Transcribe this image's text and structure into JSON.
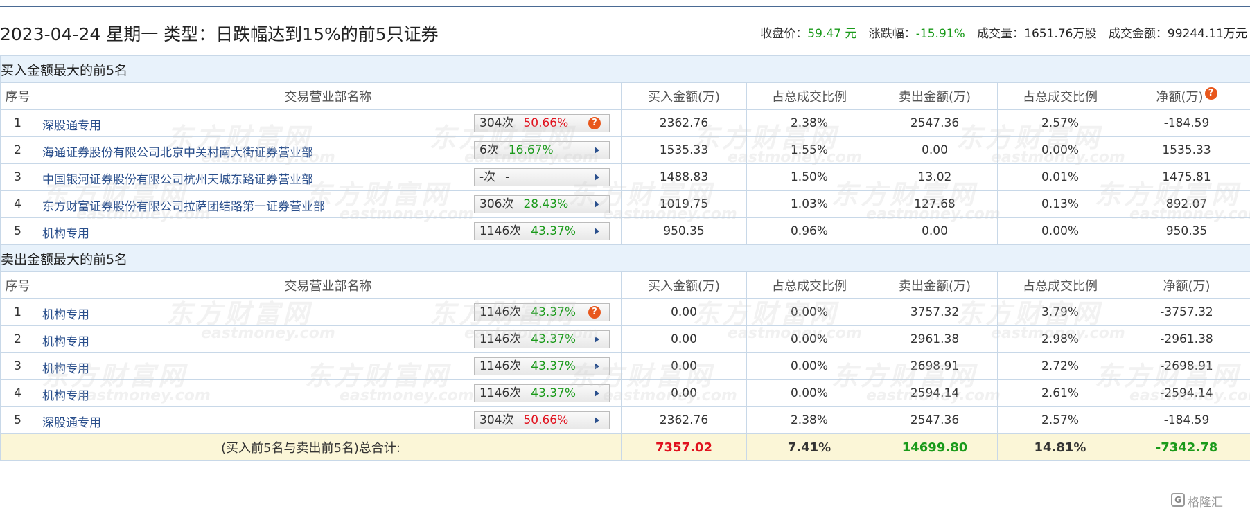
{
  "header": {
    "title": "2023-04-24 星期一 类型：日跌幅达到15%的前5只证券",
    "close_label": "收盘价：",
    "close_value": "59.47 元",
    "change_label": "涨跌幅：",
    "change_value": "-15.91%",
    "volume_label": "成交量：",
    "volume_value": "1651.76万股",
    "amount_label": "成交金额：",
    "amount_value": "99244.11万元"
  },
  "columns": {
    "seq": "序号",
    "name": "交易营业部名称",
    "buy": "买入金额(万)",
    "buy_ratio": "占总成交比例",
    "sell": "卖出金额(万)",
    "sell_ratio": "占总成交比例",
    "net": "净额(万)"
  },
  "help_icon": "question-icon",
  "buy_section": {
    "title": "买入金额最大的前5名",
    "rows": [
      {
        "seq": "1",
        "name": "深股通专用",
        "count": "304次",
        "pct": "50.66%",
        "pct_color": "red",
        "buy": "2362.76",
        "buy_ratio": "2.38%",
        "sell": "2547.36",
        "sell_ratio": "2.57%",
        "net": "-184.59"
      },
      {
        "seq": "2",
        "name": "海通证券股份有限公司北京中关村南大街证券营业部",
        "count": "6次",
        "pct": "16.67%",
        "pct_color": "green",
        "buy": "1535.33",
        "buy_ratio": "1.55%",
        "sell": "0.00",
        "sell_ratio": "0.00%",
        "net": "1535.33"
      },
      {
        "seq": "3",
        "name": "中国银河证券股份有限公司杭州天城东路证券营业部",
        "count": "-次",
        "pct": "-",
        "pct_color": "plain",
        "buy": "1488.83",
        "buy_ratio": "1.50%",
        "sell": "13.02",
        "sell_ratio": "0.01%",
        "net": "1475.81"
      },
      {
        "seq": "4",
        "name": "东方财富证券股份有限公司拉萨团结路第一证券营业部",
        "count": "306次",
        "pct": "28.43%",
        "pct_color": "green",
        "buy": "1019.75",
        "buy_ratio": "1.03%",
        "sell": "127.68",
        "sell_ratio": "0.13%",
        "net": "892.07"
      },
      {
        "seq": "5",
        "name": "机构专用",
        "count": "1146次",
        "pct": "43.37%",
        "pct_color": "green",
        "buy": "950.35",
        "buy_ratio": "0.96%",
        "sell": "0.00",
        "sell_ratio": "0.00%",
        "net": "950.35"
      }
    ]
  },
  "sell_section": {
    "title": "卖出金额最大的前5名",
    "rows": [
      {
        "seq": "1",
        "name": "机构专用",
        "count": "1146次",
        "pct": "43.37%",
        "pct_color": "green",
        "buy": "0.00",
        "buy_ratio": "0.00%",
        "sell": "3757.32",
        "sell_ratio": "3.79%",
        "net": "-3757.32"
      },
      {
        "seq": "2",
        "name": "机构专用",
        "count": "1146次",
        "pct": "43.37%",
        "pct_color": "green",
        "buy": "0.00",
        "buy_ratio": "0.00%",
        "sell": "2961.38",
        "sell_ratio": "2.98%",
        "net": "-2961.38"
      },
      {
        "seq": "3",
        "name": "机构专用",
        "count": "1146次",
        "pct": "43.37%",
        "pct_color": "green",
        "buy": "0.00",
        "buy_ratio": "0.00%",
        "sell": "2698.91",
        "sell_ratio": "2.72%",
        "net": "-2698.91"
      },
      {
        "seq": "4",
        "name": "机构专用",
        "count": "1146次",
        "pct": "43.37%",
        "pct_color": "green",
        "buy": "0.00",
        "buy_ratio": "0.00%",
        "sell": "2594.14",
        "sell_ratio": "2.61%",
        "net": "-2594.14"
      },
      {
        "seq": "5",
        "name": "深股通专用",
        "count": "304次",
        "pct": "50.66%",
        "pct_color": "red",
        "buy": "2362.76",
        "buy_ratio": "2.38%",
        "sell": "2547.36",
        "sell_ratio": "2.57%",
        "net": "-184.59"
      }
    ]
  },
  "total": {
    "label": "(买入前5名与卖出前5名)总合计:",
    "buy": "7357.02",
    "buy_ratio": "7.41%",
    "sell": "14699.80",
    "sell_ratio": "14.81%",
    "net": "-7342.78"
  },
  "watermark": {
    "cn": "东方财富网",
    "en": "eastmoney.com"
  },
  "badge": {
    "text": "格隆汇"
  },
  "colors": {
    "red": "#e0121e",
    "green": "#1a9a1a",
    "link": "#2a4f8c",
    "section_bg": "#e8f2fb",
    "total_bg": "#fbf6d7"
  }
}
